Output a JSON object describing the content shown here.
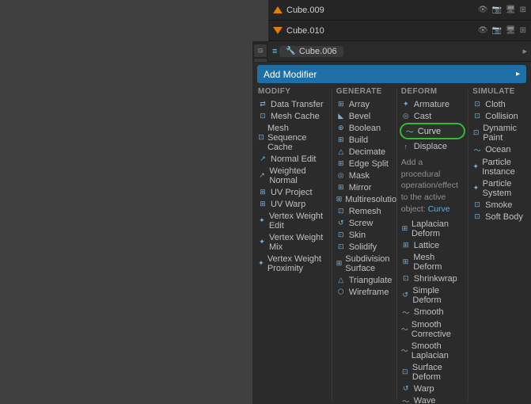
{
  "viewport": {
    "bg_color": "#3a3a3a"
  },
  "header": {
    "row1": {
      "obj1_name": "Cube.009",
      "obj2_name": "Cube.010"
    },
    "row2": {
      "active_obj": "Cube.006",
      "tab_label": "⊞"
    }
  },
  "add_modifier_label": "Add Modifier",
  "columns": {
    "modify": {
      "header": "Modify",
      "items": [
        {
          "label": "Data Transfer",
          "icon": "⇄"
        },
        {
          "label": "Mesh Cache",
          "icon": "⊡"
        },
        {
          "label": "Mesh Sequence Cache",
          "icon": "⊡"
        },
        {
          "label": "Normal Edit",
          "icon": "↗"
        },
        {
          "label": "Weighted Normal",
          "icon": "↗"
        },
        {
          "label": "UV Project",
          "icon": "⊞"
        },
        {
          "label": "UV Warp",
          "icon": "⊞"
        },
        {
          "label": "Vertex Weight Edit",
          "icon": "✦"
        },
        {
          "label": "Vertex Weight Mix",
          "icon": "✦"
        },
        {
          "label": "Vertex Weight Proximity",
          "icon": "✦"
        }
      ]
    },
    "generate": {
      "header": "Generate",
      "items": [
        {
          "label": "Array",
          "icon": "⊞"
        },
        {
          "label": "Bevel",
          "icon": "◣"
        },
        {
          "label": "Boolean",
          "icon": "⊕"
        },
        {
          "label": "Build",
          "icon": "⊞"
        },
        {
          "label": "Decimate",
          "icon": "△"
        },
        {
          "label": "Edge Split",
          "icon": "⊞"
        },
        {
          "label": "Mask",
          "icon": "◎"
        },
        {
          "label": "Mirror",
          "icon": "⊞"
        },
        {
          "label": "Multiresolution",
          "icon": "⊞"
        },
        {
          "label": "Remesh",
          "icon": "⊡"
        },
        {
          "label": "Screw",
          "icon": "↺"
        },
        {
          "label": "Skin",
          "icon": "⊡"
        },
        {
          "label": "Solidify",
          "icon": "⊡"
        },
        {
          "label": "Subdivision Surface",
          "icon": "⊞"
        },
        {
          "label": "Triangulate",
          "icon": "△"
        },
        {
          "label": "Wireframe",
          "icon": "⬡"
        }
      ]
    },
    "deform": {
      "header": "Deform",
      "items_before_curve": [
        {
          "label": "Armature",
          "icon": "✦"
        },
        {
          "label": "Cast",
          "icon": "◎"
        }
      ],
      "curve_item": {
        "label": "Curve",
        "icon": "~"
      },
      "items_after_curve": [
        {
          "label": "Displace",
          "icon": "↑"
        },
        {
          "label": "Laplacian Deform",
          "icon": "⊞"
        },
        {
          "label": "Lattice",
          "icon": "⊞"
        },
        {
          "label": "Mesh Deform",
          "icon": "⊞"
        },
        {
          "label": "Shrinkwrap",
          "icon": "⊡"
        },
        {
          "label": "Simple Deform",
          "icon": "↺"
        },
        {
          "label": "Smooth",
          "icon": "~"
        },
        {
          "label": "Smooth Corrective",
          "icon": "~"
        },
        {
          "label": "Smooth Laplacian",
          "icon": "~"
        },
        {
          "label": "Surface Deform",
          "icon": "⊡"
        },
        {
          "label": "Warp",
          "icon": "↺"
        },
        {
          "label": "Wave",
          "icon": "~"
        }
      ]
    },
    "simulate": {
      "header": "Simulate",
      "items": [
        {
          "label": "Cloth",
          "icon": "⊡"
        },
        {
          "label": "Collision",
          "icon": "⊡"
        },
        {
          "label": "Dynamic Paint",
          "icon": "⊡"
        },
        {
          "label": "Ocean",
          "icon": "~"
        },
        {
          "label": "Particle Instance",
          "icon": "✦"
        },
        {
          "label": "Particle System",
          "icon": "✦"
        },
        {
          "label": "Smoke",
          "icon": "⊡"
        },
        {
          "label": "Soft Body",
          "icon": "⊡"
        }
      ]
    }
  },
  "tooltip": {
    "text_before": "Add a procedural operation/effect to the active object: ",
    "highlighted_word": "Curve"
  }
}
